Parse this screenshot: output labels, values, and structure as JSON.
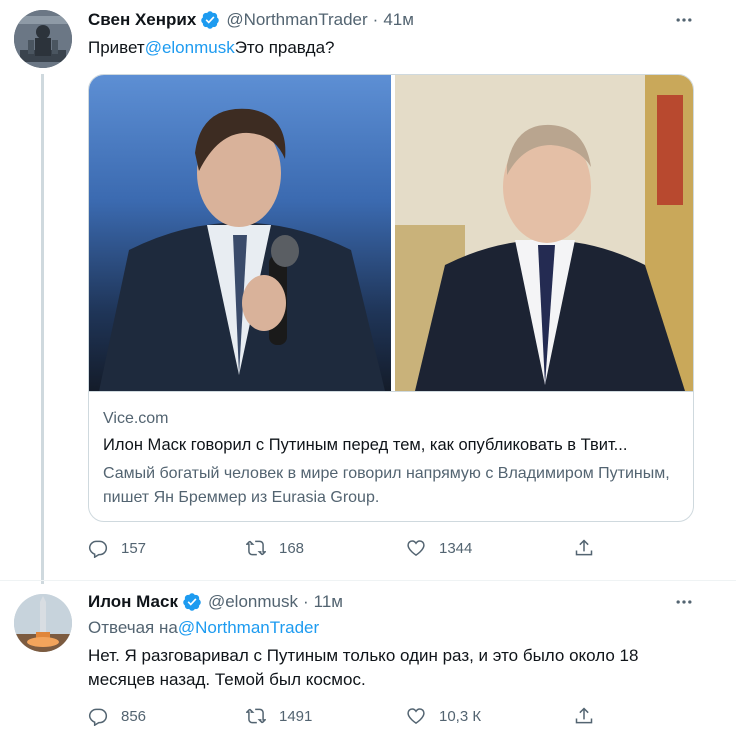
{
  "tweets": [
    {
      "author_name": "Свен Хенрих",
      "handle": "@NorthmanTrader",
      "separator": "·",
      "time": "41м",
      "text_before": "Привет",
      "mention": "@elonmusk",
      "text_after": "Это правда?",
      "card": {
        "domain": "Vice.com",
        "title": "Илон Маск говорил с Путиным перед тем, как опубликовать в Твит...",
        "description": "Самый богатый человек в мире говорил напрямую с Владимиром Путиным, пишет Ян Бреммер из Eurasia Group."
      },
      "stats": {
        "replies": "157",
        "retweets": "168",
        "likes": "1344"
      }
    },
    {
      "author_name": "Илон Маск",
      "handle": "@elonmusk",
      "separator": "·",
      "time": "11м",
      "reply_prefix": "Отвечая на",
      "reply_to": "@NorthmanTrader",
      "text": "Нет. Я разговаривал с Путиным только один раз, и это было около 18 месяцев назад. Темой был космос.",
      "stats": {
        "replies": "856",
        "retweets": "1491",
        "likes": "10,3 К"
      }
    }
  ],
  "icons": {
    "verified": "verified-badge-icon",
    "more": "more-options-icon",
    "reply": "reply-icon",
    "retweet": "retweet-icon",
    "like": "like-icon",
    "share": "share-icon"
  },
  "colors": {
    "accent": "#1d9bf0",
    "muted_text": "#536471",
    "border": "#cfd9de"
  }
}
